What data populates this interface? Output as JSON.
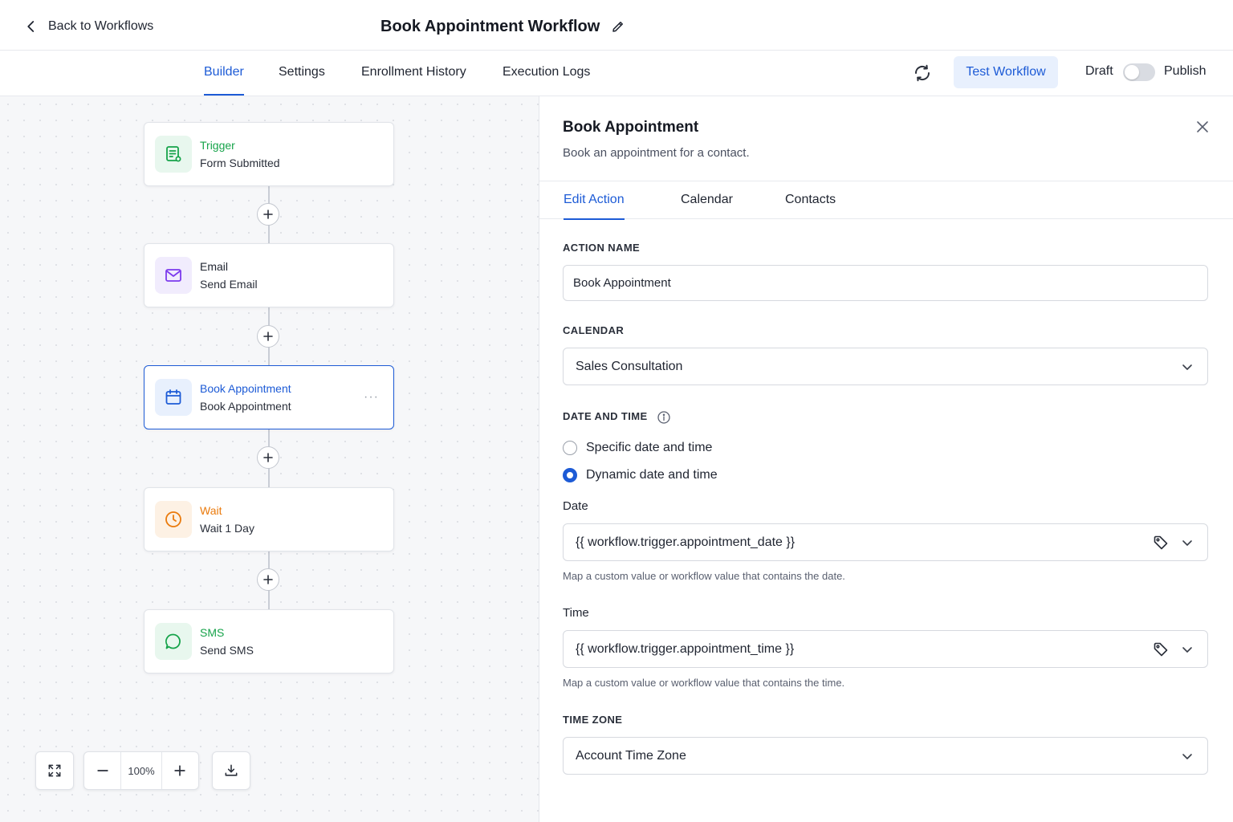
{
  "header": {
    "back_label": "Back to Workflows",
    "workflow_title": "Book Appointment Workflow"
  },
  "tabs": [
    {
      "label": "Builder",
      "active": true
    },
    {
      "label": "Settings",
      "active": false
    },
    {
      "label": "Enrollment History",
      "active": false
    },
    {
      "label": "Execution Logs",
      "active": false
    }
  ],
  "toolbar": {
    "test_label": "Test Workflow",
    "draft_label": "Draft",
    "publish_label": "Publish",
    "published": false
  },
  "nodes": [
    {
      "type": "Trigger",
      "name": "Form Submitted",
      "icon": "form-icon",
      "color": "#16a34a",
      "bg": "#e8f7ee"
    },
    {
      "type": "Email",
      "name": "Send Email",
      "icon": "mail-icon",
      "color": "#7c3aed",
      "bg": "#f1ecfd"
    },
    {
      "type": "Book Appointment",
      "name": "Book Appointment",
      "icon": "calendar-icon",
      "color": "#1d5bd6",
      "bg": "#e8f0fd",
      "selected": true
    },
    {
      "type": "Wait",
      "name": "Wait 1 Day",
      "icon": "clock-icon",
      "color": "#ea7a0c",
      "bg": "#fdf1e4"
    },
    {
      "type": "SMS",
      "name": "Send SMS",
      "icon": "chat-icon",
      "color": "#16a34a",
      "bg": "#e8f7ee"
    }
  ],
  "canvas_controls": {
    "zoom": "100%"
  },
  "panel": {
    "title": "Book Appointment",
    "subtitle": "Book an appointment for a contact.",
    "tabs": [
      {
        "label": "Edit Action",
        "active": true
      },
      {
        "label": "Calendar",
        "active": false
      },
      {
        "label": "Contacts",
        "active": false
      }
    ],
    "action_name": {
      "label": "ACTION NAME",
      "value": "Book Appointment"
    },
    "calendar": {
      "label": "CALENDAR",
      "value": "Sales Consultation"
    },
    "date_time": {
      "label": "DATE AND TIME",
      "options": [
        {
          "label": "Specific date and time",
          "selected": false
        },
        {
          "label": "Dynamic date and time",
          "selected": true
        }
      ]
    },
    "date": {
      "label": "Date",
      "value": "{{ workflow.trigger.appointment_date }}",
      "help": "Map a custom value or workflow value that contains the date."
    },
    "time": {
      "label": "Time",
      "value": "{{ workflow.trigger.appointment_time }}",
      "help": "Map a custom value or workflow value that contains the time."
    },
    "time_zone": {
      "label": "TIME ZONE",
      "value": "Account Time Zone"
    }
  },
  "colors": {
    "accent": "#1d5bd6",
    "accent_bg": "#e8f0fd"
  }
}
